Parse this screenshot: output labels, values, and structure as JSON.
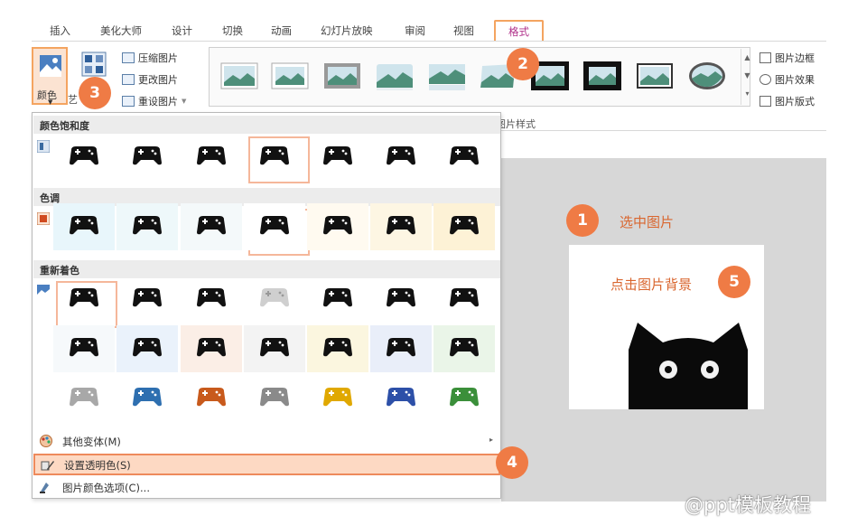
{
  "tabs": [
    "插入",
    "美化大师",
    "设计",
    "切换",
    "动画",
    "幻灯片放映",
    "审阅",
    "视图",
    "格式"
  ],
  "ribbon": {
    "color_button": "颜色",
    "partial_label": "艺",
    "compress": "压缩图片",
    "change": "更改图片",
    "reset": "重设图片",
    "border": "图片边框",
    "effects": "图片效果",
    "layout": "图片版式",
    "styles_group": "图片样式"
  },
  "dropdown": {
    "saturation": "颜色饱和度",
    "tone": "色调",
    "recolor": "重新着色",
    "more_variants": "其他变体(M)",
    "set_transparent": "设置透明色(S)",
    "color_options": "图片颜色选项(C)..."
  },
  "callouts": {
    "c1": "1",
    "c1_text": "选中图片",
    "c2": "2",
    "c3": "3",
    "c4": "4",
    "c5": "5",
    "c5_text": "点击图片背景"
  },
  "watermark": "@ppt模板教程",
  "colors": {
    "accent_orange": "#ef7b45",
    "highlight_bg": "#fdd9c3",
    "active_tab_text": "#b0308a",
    "recolor_row3": [
      "#a8a8a8",
      "#2e6fb0",
      "#c85a1c",
      "#8a8a8a",
      "#e0a800",
      "#2d50a8",
      "#3b8f3a"
    ]
  }
}
